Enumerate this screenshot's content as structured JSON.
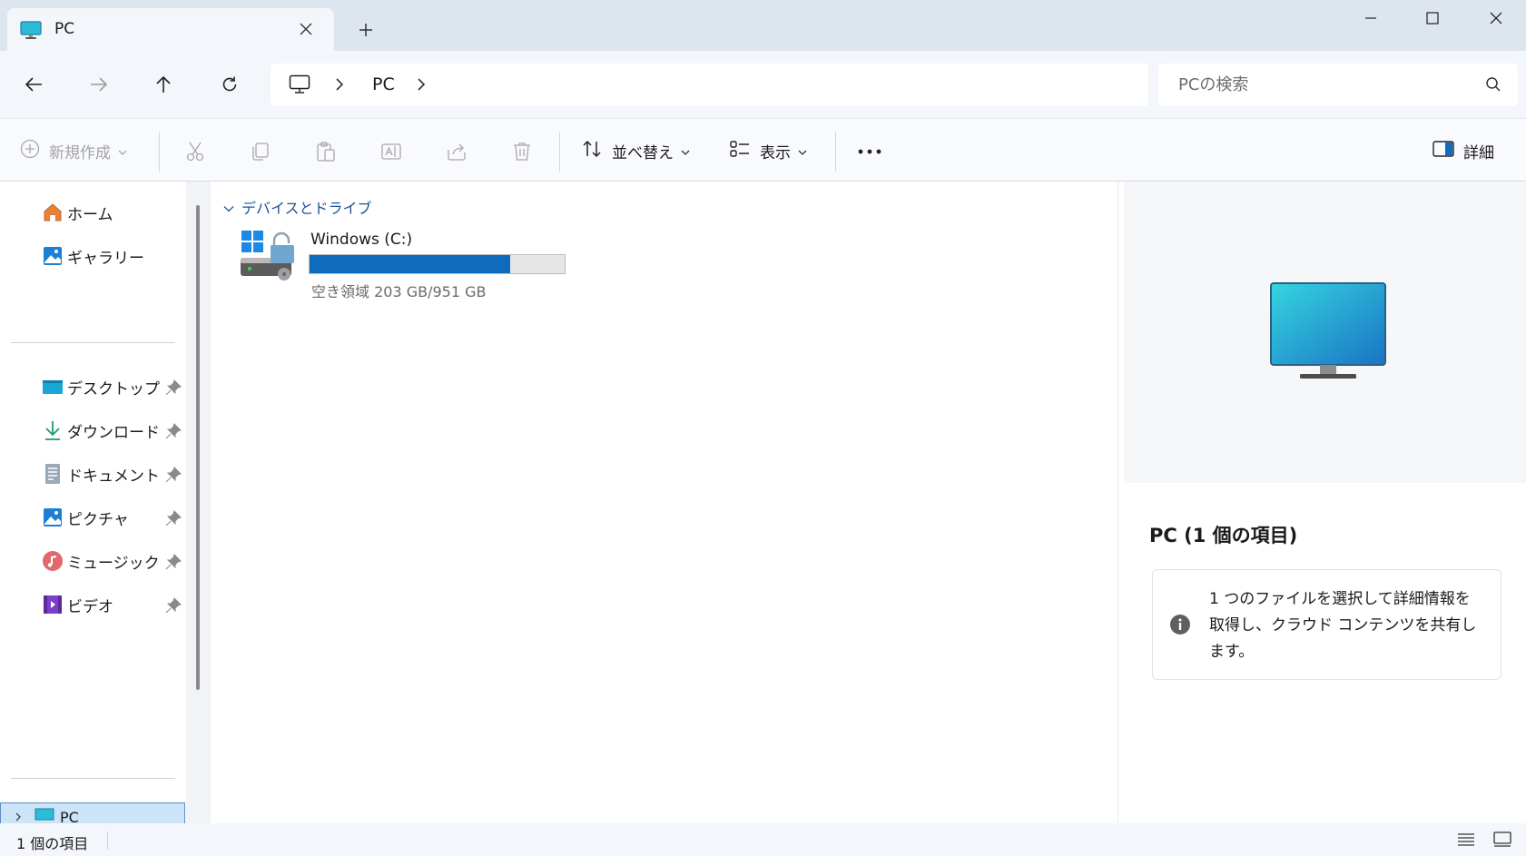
{
  "window": {
    "tab_title": "PC",
    "tab_icon": "pc-monitor-icon",
    "controls": [
      "minimize-icon",
      "maximize-icon",
      "close-icon"
    ]
  },
  "navigation": {
    "back_icon": "arrow-left-icon",
    "forward_icon": "arrow-right-icon",
    "up_icon": "arrow-up-icon",
    "refresh_icon": "refresh-icon",
    "breadcrumb": [
      "PC"
    ],
    "search_placeholder": "PCの検索"
  },
  "command_bar": {
    "new_label": "新規作成",
    "sort_label": "並べ替え",
    "view_label": "表示",
    "details_label": "詳細",
    "icons": [
      "cut-icon",
      "copy-icon",
      "paste-icon",
      "rename-icon",
      "share-icon",
      "delete-icon",
      "more-icon"
    ]
  },
  "sidebar": {
    "top_items": [
      {
        "label": "ホーム",
        "icon": "home-icon"
      },
      {
        "label": "ギャラリー",
        "icon": "gallery-icon"
      }
    ],
    "pinned_items": [
      {
        "label": "デスクトップ",
        "icon": "desktop-icon"
      },
      {
        "label": "ダウンロード",
        "icon": "download-icon"
      },
      {
        "label": "ドキュメント",
        "icon": "documents-icon"
      },
      {
        "label": "ピクチャ",
        "icon": "pictures-icon"
      },
      {
        "label": "ミュージック",
        "icon": "music-icon"
      },
      {
        "label": "ビデオ",
        "icon": "video-icon"
      }
    ],
    "selected_item": "PC"
  },
  "main": {
    "group_header": "デバイスとドライブ",
    "drives": [
      {
        "name": "Windows (C:)",
        "free_text": "空き領域 203 GB/951 GB",
        "used_fraction": 0.787
      }
    ]
  },
  "details": {
    "title": "PC (1 個の項目)",
    "info_text": "1 つのファイルを選択して詳細情報を取得し、クラウド コンテンツを共有します。"
  },
  "status": {
    "item_count": "1 個の項目"
  },
  "colors": {
    "accent": "#0f6cbd",
    "tabbar_bg": "#dde5ef",
    "selection_bg": "#cce4f7"
  }
}
